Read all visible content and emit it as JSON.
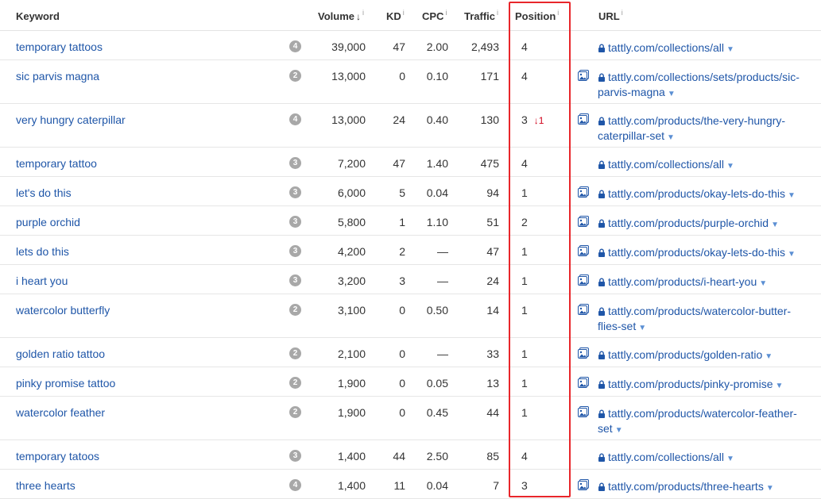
{
  "headers": {
    "keyword": "Keyword",
    "volume": "Volume",
    "sort_indicator": "↓",
    "kd": "KD",
    "cpc": "CPC",
    "traffic": "Traffic",
    "position": "Position",
    "url": "URL",
    "info": "i"
  },
  "rows": [
    {
      "keyword": "temporary tattoos",
      "badge": "4",
      "volume": "39,000",
      "kd": "47",
      "cpc": "2.00",
      "traffic": "2,493",
      "position": "4",
      "change": "",
      "serp": false,
      "url_lines": [
        "tattly.com/collections/all"
      ]
    },
    {
      "keyword": "sic parvis magna",
      "badge": "2",
      "volume": "13,000",
      "kd": "0",
      "cpc": "0.10",
      "traffic": "171",
      "position": "4",
      "change": "",
      "serp": true,
      "url_lines": [
        "tattly.com/collections/sets/products/sic-",
        "parvis-magna"
      ]
    },
    {
      "keyword": "very hungry caterpillar",
      "badge": "4",
      "volume": "13,000",
      "kd": "24",
      "cpc": "0.40",
      "traffic": "130",
      "position": "3",
      "change": "↓1",
      "serp": true,
      "url_lines": [
        "tattly.com/products/the-very-hungry-",
        "caterpillar-set"
      ]
    },
    {
      "keyword": "temporary tattoo",
      "badge": "3",
      "volume": "7,200",
      "kd": "47",
      "cpc": "1.40",
      "traffic": "475",
      "position": "4",
      "change": "",
      "serp": false,
      "url_lines": [
        "tattly.com/collections/all"
      ]
    },
    {
      "keyword": "let's do this",
      "badge": "3",
      "volume": "6,000",
      "kd": "5",
      "cpc": "0.04",
      "traffic": "94",
      "position": "1",
      "change": "",
      "serp": true,
      "url_lines": [
        "tattly.com/products/okay-lets-do-this"
      ]
    },
    {
      "keyword": "purple orchid",
      "badge": "3",
      "volume": "5,800",
      "kd": "1",
      "cpc": "1.10",
      "traffic": "51",
      "position": "2",
      "change": "",
      "serp": true,
      "url_lines": [
        "tattly.com/products/purple-orchid"
      ]
    },
    {
      "keyword": "lets do this",
      "badge": "3",
      "volume": "4,200",
      "kd": "2",
      "cpc": "—",
      "traffic": "47",
      "position": "1",
      "change": "",
      "serp": true,
      "url_lines": [
        "tattly.com/products/okay-lets-do-this"
      ]
    },
    {
      "keyword": "i heart you",
      "badge": "3",
      "volume": "3,200",
      "kd": "3",
      "cpc": "—",
      "traffic": "24",
      "position": "1",
      "change": "",
      "serp": true,
      "url_lines": [
        "tattly.com/products/i-heart-you"
      ]
    },
    {
      "keyword": "watercolor butterfly",
      "badge": "2",
      "volume": "3,100",
      "kd": "0",
      "cpc": "0.50",
      "traffic": "14",
      "position": "1",
      "change": "",
      "serp": true,
      "url_lines": [
        "tattly.com/products/watercolor-butter-",
        "flies-set"
      ]
    },
    {
      "keyword": "golden ratio tattoo",
      "badge": "2",
      "volume": "2,100",
      "kd": "0",
      "cpc": "—",
      "traffic": "33",
      "position": "1",
      "change": "",
      "serp": true,
      "url_lines": [
        "tattly.com/products/golden-ratio"
      ]
    },
    {
      "keyword": "pinky promise tattoo",
      "badge": "2",
      "volume": "1,900",
      "kd": "0",
      "cpc": "0.05",
      "traffic": "13",
      "position": "1",
      "change": "",
      "serp": true,
      "url_lines": [
        "tattly.com/products/pinky-promise"
      ]
    },
    {
      "keyword": "watercolor feather",
      "badge": "2",
      "volume": "1,900",
      "kd": "0",
      "cpc": "0.45",
      "traffic": "44",
      "position": "1",
      "change": "",
      "serp": true,
      "url_lines": [
        "tattly.com/products/watercolor-feather-",
        "set"
      ]
    },
    {
      "keyword": "temporary tatoos",
      "badge": "3",
      "volume": "1,400",
      "kd": "44",
      "cpc": "2.50",
      "traffic": "85",
      "position": "4",
      "change": "",
      "serp": false,
      "url_lines": [
        "tattly.com/collections/all"
      ]
    },
    {
      "keyword": "three hearts",
      "badge": "4",
      "volume": "1,400",
      "kd": "11",
      "cpc": "0.04",
      "traffic": "7",
      "position": "3",
      "change": "",
      "serp": true,
      "url_lines": [
        "tattly.com/products/three-hearts"
      ]
    }
  ],
  "icons": {
    "lock": "lock-icon",
    "serp": "serp-features-icon",
    "dropdown": "chevron-down-icon",
    "info": "info-icon"
  },
  "colors": {
    "link": "#1f56a8",
    "highlight": "#e8262b",
    "down_change": "#d0021b",
    "badge": "#a8a8a8"
  }
}
